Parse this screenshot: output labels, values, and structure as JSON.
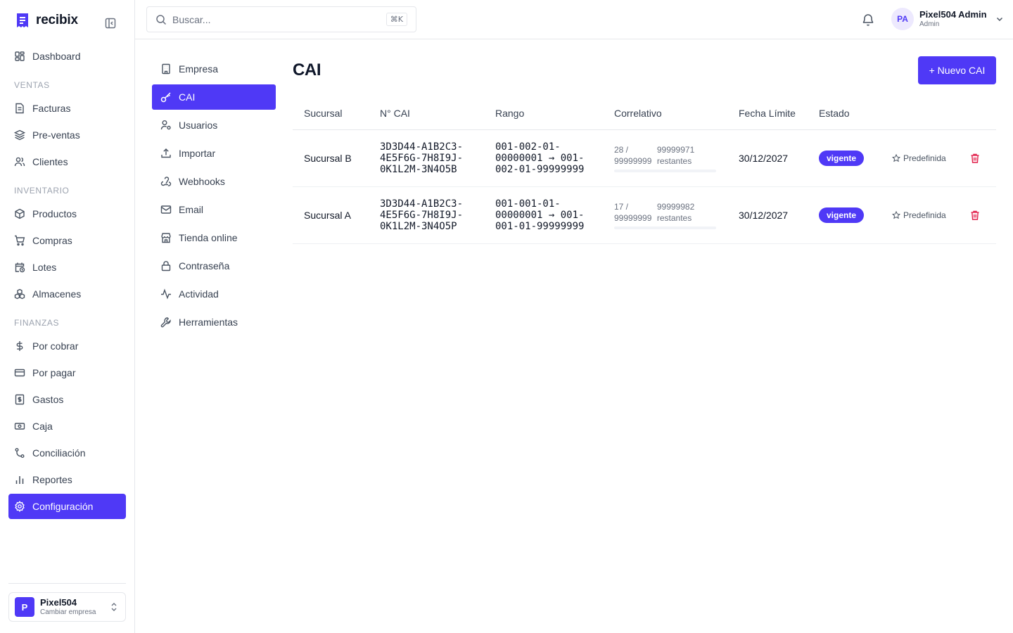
{
  "app": {
    "name": "recibix"
  },
  "sidebar": {
    "items": [
      {
        "label": "Dashboard",
        "icon": "dashboard-icon"
      },
      {
        "section": "VENTAS"
      },
      {
        "label": "Facturas",
        "icon": "invoice-icon"
      },
      {
        "label": "Pre-ventas",
        "icon": "layers-icon"
      },
      {
        "label": "Clientes",
        "icon": "users-icon"
      },
      {
        "section": "INVENTARIO"
      },
      {
        "label": "Productos",
        "icon": "package-icon"
      },
      {
        "label": "Compras",
        "icon": "cart-icon"
      },
      {
        "label": "Lotes",
        "icon": "calendar-clock-icon"
      },
      {
        "label": "Almacenes",
        "icon": "boxes-icon"
      },
      {
        "section": "FINANZAS"
      },
      {
        "label": "Por cobrar",
        "icon": "dollar-icon"
      },
      {
        "label": "Por pagar",
        "icon": "credit-card-icon"
      },
      {
        "label": "Gastos",
        "icon": "receipt-dollar-icon"
      },
      {
        "label": "Caja",
        "icon": "cash-icon"
      },
      {
        "label": "Conciliación",
        "icon": "git-compare-icon"
      },
      {
        "label": "Reportes",
        "icon": "bar-chart-icon"
      },
      {
        "label": "Configuración",
        "icon": "gear-icon",
        "active": true
      }
    ],
    "company": {
      "initial": "P",
      "name": "Pixel504",
      "action": "Cambiar empresa"
    }
  },
  "topbar": {
    "search_placeholder": "Buscar...",
    "search_shortcut": "⌘K",
    "user": {
      "initials": "PA",
      "name": "Pixel504 Admin",
      "role": "Admin"
    }
  },
  "settings_nav": [
    {
      "label": "Empresa",
      "icon": "building-icon"
    },
    {
      "label": "CAI",
      "icon": "key-icon",
      "active": true
    },
    {
      "label": "Usuarios",
      "icon": "user-cog-icon"
    },
    {
      "label": "Importar",
      "icon": "upload-icon"
    },
    {
      "label": "Webhooks",
      "icon": "webhook-icon"
    },
    {
      "label": "Email",
      "icon": "mail-icon"
    },
    {
      "label": "Tienda online",
      "icon": "store-icon"
    },
    {
      "label": "Contraseña",
      "icon": "lock-icon"
    },
    {
      "label": "Actividad",
      "icon": "activity-icon"
    },
    {
      "label": "Herramientas",
      "icon": "wrench-icon"
    }
  ],
  "main": {
    "title": "CAI",
    "new_button": "+ Nuevo CAI",
    "columns": [
      "Sucursal",
      "N° CAI",
      "Rango",
      "Correlativo",
      "Fecha Límite",
      "Estado"
    ],
    "rows": [
      {
        "sucursal": "Sucursal B",
        "cai": "3D3D44-A1B2C3-4E5F6G-7H8I9J-0K1L2M-3N4O5B",
        "rango": "001-002-01-00000001 → 001-002-01-99999999",
        "correlativo": "28 / 99999999",
        "restantes": "99999971 restantes",
        "progress": 2.8e-07,
        "fecha": "30/12/2027",
        "estado": "vigente",
        "predefinida": "Predefinida"
      },
      {
        "sucursal": "Sucursal A",
        "cai": "3D3D44-A1B2C3-4E5F6G-7H8I9J-0K1L2M-3N4O5P",
        "rango": "001-001-01-00000001 → 001-001-01-99999999",
        "correlativo": "17 / 99999999",
        "restantes": "99999982 restantes",
        "progress": 1.7e-07,
        "fecha": "30/12/2027",
        "estado": "vigente",
        "predefinida": "Predefinida"
      }
    ]
  },
  "colors": {
    "accent": "#4f39f6",
    "danger": "#e11d48",
    "border": "#e5e7eb"
  }
}
